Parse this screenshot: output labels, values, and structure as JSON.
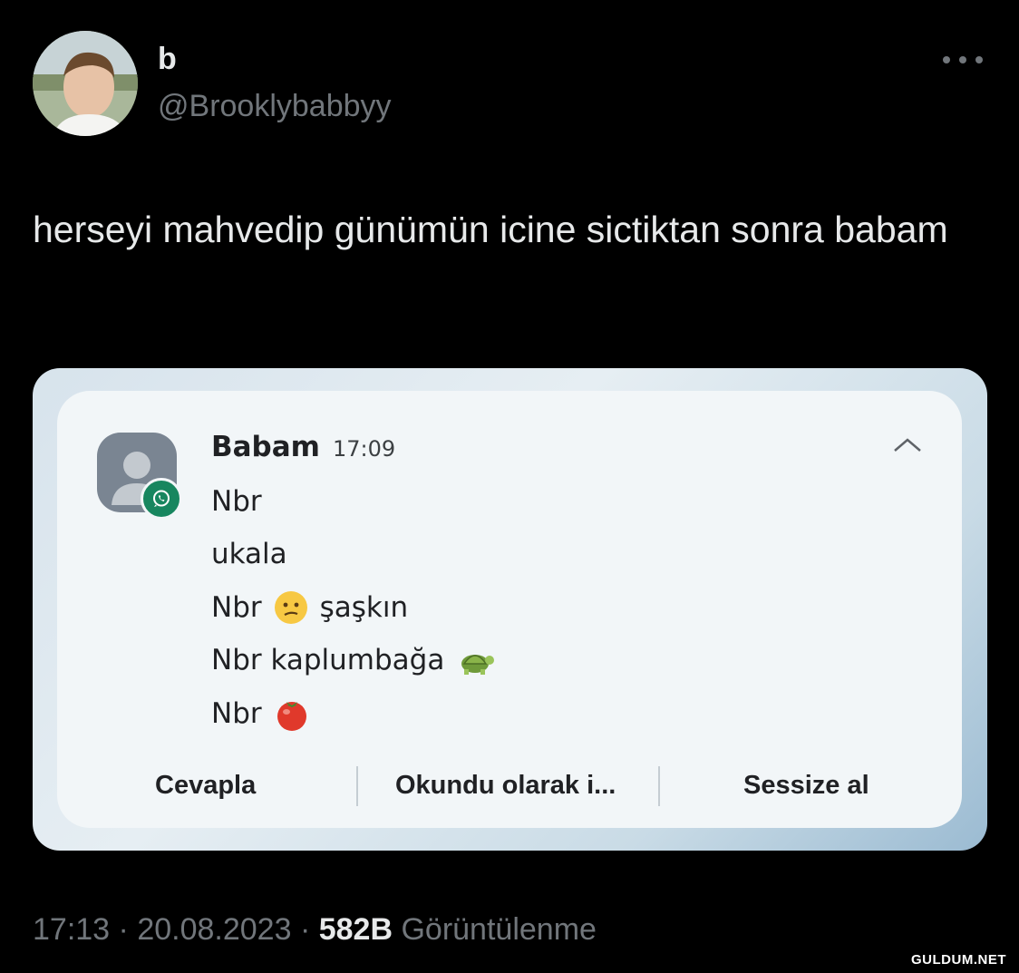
{
  "tweet": {
    "display_name": "b",
    "handle": "@Brooklybabbyy",
    "text": "herseyi mahvedip günümün icine sictiktan sonra babam",
    "time": "17:13",
    "date": "20.08.2023",
    "views_count": "582B",
    "views_label": "Görüntülenme",
    "separator": "·"
  },
  "notification": {
    "sender": "Babam",
    "time": "17:09",
    "app_badge_icon": "whatsapp-icon",
    "messages": [
      {
        "text": "Nbr",
        "emoji": ""
      },
      {
        "text": "ukala",
        "emoji": ""
      },
      {
        "text": "Nbr",
        "emoji": "😕",
        "after": "şaşkın"
      },
      {
        "text": "Nbr kaplumbağa",
        "emoji": "🐢"
      },
      {
        "text": "Nbr",
        "emoji": "🍅"
      }
    ],
    "actions": {
      "reply": "Cevapla",
      "mark_read": "Okundu olarak i...",
      "mute": "Sessize al"
    }
  },
  "watermark": "GULDUM.NET",
  "colors": {
    "background": "#000000",
    "text_primary": "#e7e9ea",
    "text_secondary": "#71767b",
    "whatsapp_green": "#17865f"
  }
}
